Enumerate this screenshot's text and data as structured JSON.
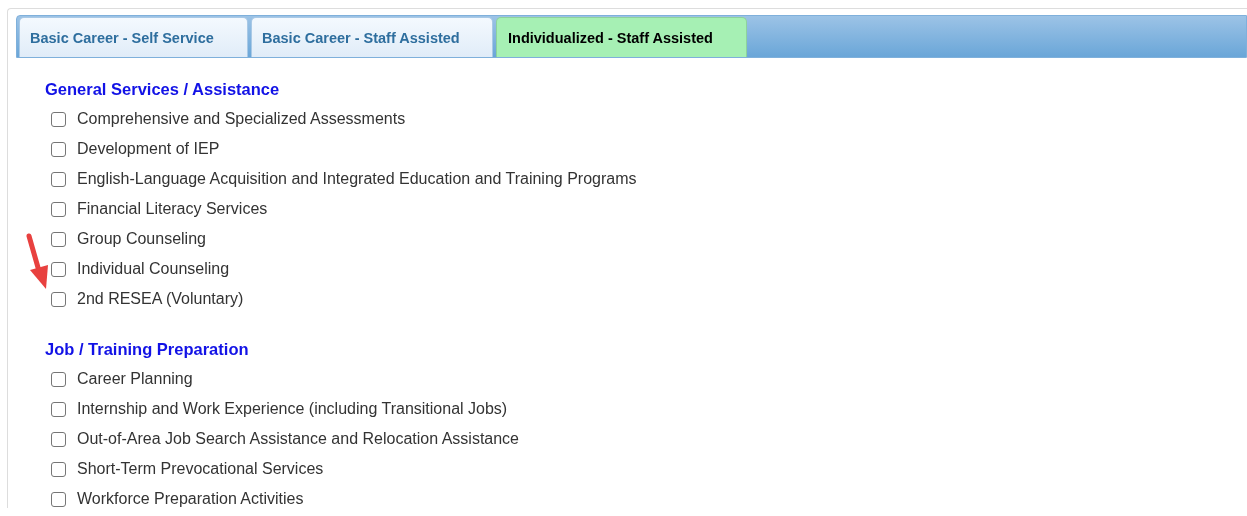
{
  "tabs": [
    {
      "label": "Basic Career - Self Service",
      "selected": false
    },
    {
      "label": "Basic Career - Staff Assisted",
      "selected": false
    },
    {
      "label": "Individualized - Staff Assisted",
      "selected": true
    }
  ],
  "sections": [
    {
      "title": "General Services / Assistance",
      "items": [
        {
          "label": "Comprehensive and Specialized Assessments",
          "checked": false
        },
        {
          "label": "Development of IEP",
          "checked": false
        },
        {
          "label": "English-Language Acquisition and Integrated Education and Training Programs",
          "checked": false
        },
        {
          "label": "Financial Literacy Services",
          "checked": false
        },
        {
          "label": "Group Counseling",
          "checked": false
        },
        {
          "label": "Individual Counseling",
          "checked": false
        },
        {
          "label": "2nd RESEA (Voluntary)",
          "checked": false
        }
      ]
    },
    {
      "title": "Job / Training Preparation",
      "items": [
        {
          "label": "Career Planning",
          "checked": false
        },
        {
          "label": "Internship and Work Experience (including Transitional Jobs)",
          "checked": false
        },
        {
          "label": "Out-of-Area Job Search Assistance and Relocation Assistance",
          "checked": false
        },
        {
          "label": "Short-Term Prevocational Services",
          "checked": false
        },
        {
          "label": "Workforce Preparation Activities",
          "checked": false
        }
      ]
    }
  ]
}
